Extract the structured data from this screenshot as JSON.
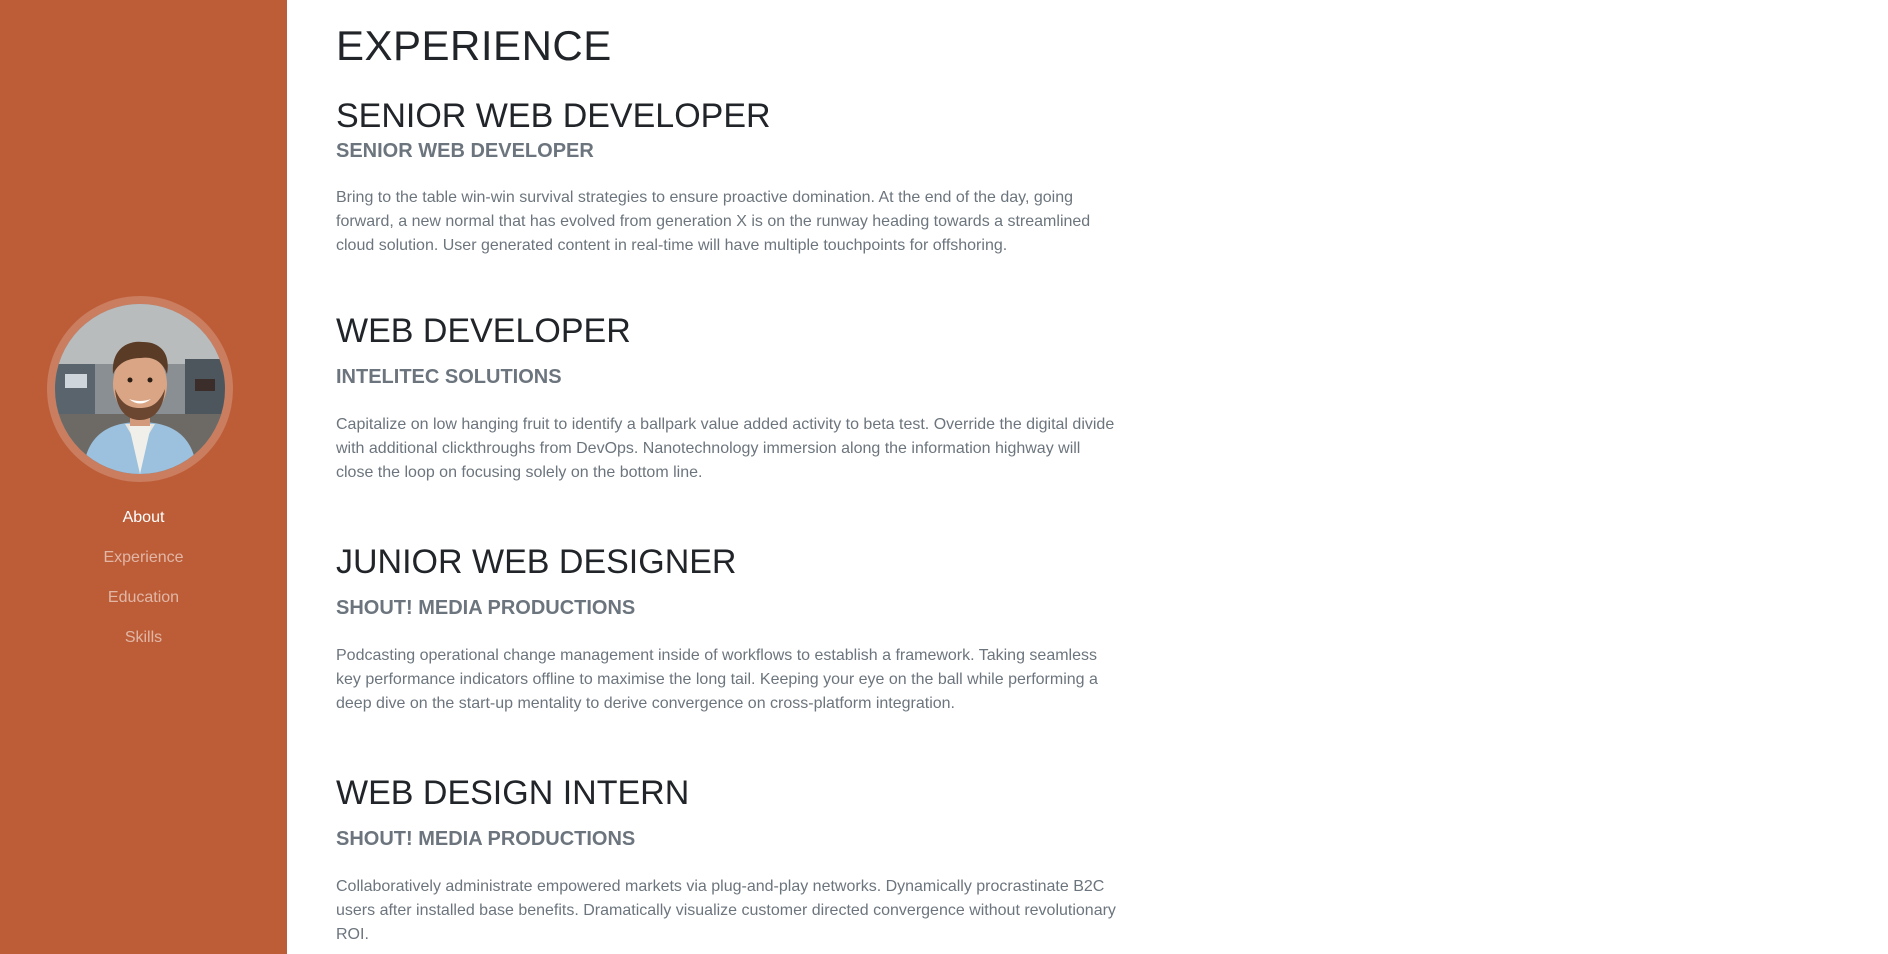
{
  "theme": {
    "accent": "#bd5d38",
    "heading": "#212529",
    "muted": "#6c757d"
  },
  "sidebar": {
    "avatar_alt": "profile photo",
    "nav": [
      {
        "label": "About",
        "active": true
      },
      {
        "label": "Experience",
        "active": false
      },
      {
        "label": "Education",
        "active": false
      },
      {
        "label": "Skills",
        "active": false
      }
    ]
  },
  "main": {
    "section_title": "EXPERIENCE",
    "jobs": [
      {
        "title": "SENIOR WEB DEVELOPER",
        "company": "SENIOR WEB DEVELOPER",
        "description": "Bring to the table win-win survival strategies to ensure proactive domination. At the end of the day, going forward, a new normal that has evolved from generation X is on the runway heading towards a streamlined cloud solution. User generated content in real-time will have multiple touchpoints for offshoring."
      },
      {
        "title": "WEB DEVELOPER",
        "company": "INTELITEC SOLUTIONS",
        "description": "Capitalize on low hanging fruit to identify a ballpark value added activity to beta test. Override the digital divide with additional clickthroughs from DevOps. Nanotechnology immersion along the information highway will close the loop on focusing solely on the bottom line."
      },
      {
        "title": "JUNIOR WEB DESIGNER",
        "company": "SHOUT! MEDIA PRODUCTIONS",
        "description": "Podcasting operational change management inside of workflows to establish a framework. Taking seamless key performance indicators offline to maximise the long tail. Keeping your eye on the ball while performing a deep dive on the start-up mentality to derive convergence on cross-platform integration."
      },
      {
        "title": "WEB DESIGN INTERN",
        "company": "SHOUT! MEDIA PRODUCTIONS",
        "description": "Collaboratively administrate empowered markets via plug-and-play networks. Dynamically procrastinate B2C users after installed base benefits. Dramatically visualize customer directed convergence without revolutionary ROI."
      }
    ]
  }
}
